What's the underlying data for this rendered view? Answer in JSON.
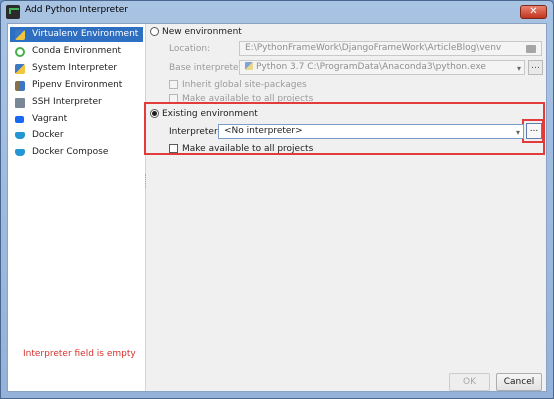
{
  "window": {
    "title": "Add Python Interpreter",
    "close_label": "✕"
  },
  "sidebar": {
    "items": [
      {
        "label": "Virtualenv Environment",
        "icon": "virtualenv-icon",
        "selected": true
      },
      {
        "label": "Conda Environment",
        "icon": "conda-icon"
      },
      {
        "label": "System Interpreter",
        "icon": "python-icon"
      },
      {
        "label": "Pipenv Environment",
        "icon": "pipenv-icon"
      },
      {
        "label": "SSH Interpreter",
        "icon": "ssh-icon"
      },
      {
        "label": "Vagrant",
        "icon": "vagrant-icon"
      },
      {
        "label": "Docker",
        "icon": "docker-icon"
      },
      {
        "label": "Docker Compose",
        "icon": "docker-compose-icon"
      }
    ]
  },
  "new_env": {
    "label": "New environment",
    "location_label": "Location:",
    "location_value": "E:\\PythonFrameWork\\DjangoFrameWork\\ArticleBlog\\venv",
    "base_label": "Base interpreter:",
    "base_value": "Python 3.7 C:\\ProgramData\\Anaconda3\\python.exe",
    "inherit_label": "Inherit global site-packages",
    "available_label": "Make available to all projects"
  },
  "existing_env": {
    "label": "Existing environment",
    "interpreter_label": "Interpreter:",
    "interpreter_value": "<No interpreter>",
    "browse_label": "...",
    "available_label": "Make available to all projects"
  },
  "error": "Interpreter field is empty",
  "buttons": {
    "ok": "OK",
    "cancel": "Cancel"
  },
  "colors": {
    "selection": "#2f6fc1",
    "error": "#d8312d",
    "highlight": "#e23b3b"
  }
}
